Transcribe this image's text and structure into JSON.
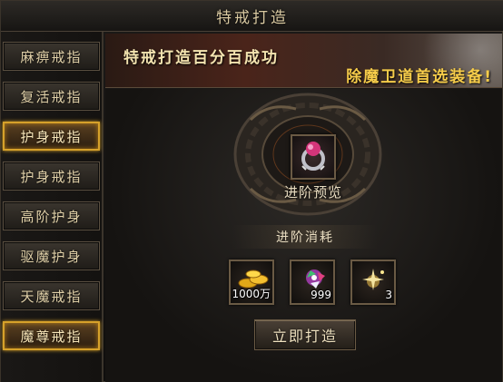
{
  "window": {
    "title": "特戒打造"
  },
  "sidebar": {
    "items": [
      {
        "label": "麻痹戒指",
        "active": false
      },
      {
        "label": "复活戒指",
        "active": false
      },
      {
        "label": "护身戒指",
        "active": true
      },
      {
        "label": "护身戒指",
        "active": false
      },
      {
        "label": "高阶护身",
        "active": false
      },
      {
        "label": "驱魔护身",
        "active": false
      },
      {
        "label": "天魔戒指",
        "active": false
      },
      {
        "label": "魔尊戒指",
        "active": true
      }
    ]
  },
  "banner": {
    "line1": "特戒打造百分百成功",
    "line2": "除魔卫道首选装备!"
  },
  "main": {
    "preview_label": "进阶预览",
    "cost_header": "进阶消耗",
    "costs": [
      {
        "icon": "gold-ingots-icon",
        "qty": "1000万"
      },
      {
        "icon": "gem-cluster-icon",
        "qty": "999"
      },
      {
        "icon": "sparkle-material-icon",
        "qty": "3"
      }
    ],
    "forge_button": "立即打造"
  },
  "colors": {
    "accent_gold": "#d6a12a",
    "banner_text": "#f6cc4a",
    "label_text": "#e0d0a8"
  }
}
